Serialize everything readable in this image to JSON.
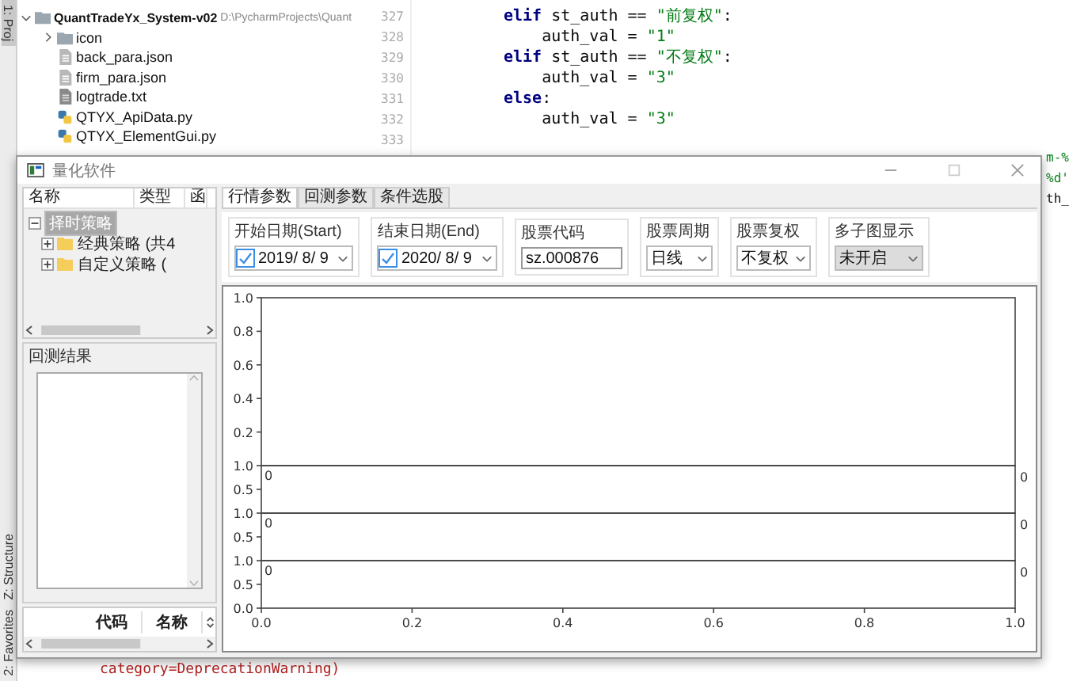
{
  "ide": {
    "tool_tabs": [
      {
        "label": "1: Proj",
        "selected": true
      },
      {
        "label": "Z: Structure",
        "selected": false
      },
      {
        "label": "2: Favorites",
        "selected": false
      }
    ],
    "project": {
      "root": {
        "name": "QuantTradeYx_System-v02",
        "path": "D:\\PycharmProjects\\Quant",
        "expanded": true
      },
      "items": [
        {
          "kind": "folder",
          "name": "icon",
          "expanded": false
        },
        {
          "kind": "json",
          "name": "back_para.json"
        },
        {
          "kind": "json",
          "name": "firm_para.json"
        },
        {
          "kind": "txt",
          "name": "logtrade.txt"
        },
        {
          "kind": "py",
          "name": "QTYX_ApiData.py"
        },
        {
          "kind": "py",
          "name": "QTYX_ElementGui.py"
        }
      ]
    },
    "editor": {
      "line_numbers": [
        "327",
        "328",
        "329",
        "330",
        "331",
        "332",
        "333"
      ],
      "lines": [
        [
          {
            "kind": "keyword",
            "text": "elif"
          },
          {
            "kind": "plain",
            "text": " st_auth == "
          },
          {
            "kind": "string",
            "text": "\"前复权\""
          },
          {
            "kind": "plain",
            "text": ":"
          }
        ],
        [
          {
            "kind": "plain",
            "text": "    auth_val = "
          },
          {
            "kind": "string",
            "text": "\"1\""
          }
        ],
        [
          {
            "kind": "keyword",
            "text": "elif"
          },
          {
            "kind": "plain",
            "text": " st_auth == "
          },
          {
            "kind": "string",
            "text": "\"不复权\""
          },
          {
            "kind": "plain",
            "text": ":"
          }
        ],
        [
          {
            "kind": "plain",
            "text": "    auth_val = "
          },
          {
            "kind": "string",
            "text": "\"3\""
          }
        ],
        [
          {
            "kind": "keyword",
            "text": "else"
          },
          {
            "kind": "plain",
            "text": ":"
          }
        ],
        [
          {
            "kind": "plain",
            "text": "    auth_val = "
          },
          {
            "kind": "string",
            "text": "\"3\""
          }
        ]
      ],
      "fragments": [
        {
          "kind": "string",
          "text": "m-%"
        },
        {
          "kind": "string",
          "text": "%d'"
        },
        {
          "kind": "plain",
          "text": "th_"
        }
      ]
    },
    "console_line": "category=DeprecationWarning)"
  },
  "app": {
    "title": "量化软件",
    "tree_columns": [
      "名称",
      "类型",
      "函"
    ],
    "tree": [
      {
        "label": "择时策略",
        "selected": true,
        "expanded": true,
        "children": [
          {
            "label": "经典策略 (共4",
            "selected": false,
            "expanded": false
          },
          {
            "label": "自定义策略 (",
            "selected": false,
            "expanded": false
          }
        ]
      }
    ],
    "results_title": "回测结果",
    "table_columns": [
      "代码",
      "名称"
    ],
    "tabs": [
      {
        "label": "行情参数",
        "selected": true
      },
      {
        "label": "回测参数",
        "selected": false
      },
      {
        "label": "条件选股",
        "selected": false
      }
    ],
    "params": [
      {
        "kind": "date",
        "label": "开始日期(Start)",
        "checked": true,
        "value": "2019/ 8/ 9"
      },
      {
        "kind": "date",
        "label": "结束日期(End)",
        "checked": true,
        "value": "2020/ 8/ 9"
      },
      {
        "kind": "text",
        "label": "股票代码",
        "value": "sz.000876"
      },
      {
        "kind": "select",
        "label": "股票周期",
        "value": "日线",
        "readonly": false
      },
      {
        "kind": "select",
        "label": "股票复权",
        "value": "不复权",
        "readonly": false
      },
      {
        "kind": "select",
        "label": "多子图显示",
        "value": "未开启",
        "readonly": true
      }
    ],
    "figure": {
      "panels": [
        {
          "y_tick_labels": [
            "1.0",
            "0.8",
            "0.6",
            "0.4",
            "0.2"
          ]
        },
        {
          "y_tick_labels": [
            "1.0",
            "0.5"
          ],
          "left_fragment": "0",
          "right_fragment": "0"
        },
        {
          "y_tick_labels": [
            "1.0",
            "0.5"
          ],
          "left_fragment": "0",
          "right_fragment": "0"
        },
        {
          "y_tick_labels": [
            "1.0",
            "0.5",
            "0.0"
          ],
          "left_fragment": "0",
          "right_fragment": "0"
        }
      ],
      "x_tick_labels": [
        "0.0",
        "0.2",
        "0.4",
        "0.6",
        "0.8",
        "1.0"
      ]
    }
  }
}
